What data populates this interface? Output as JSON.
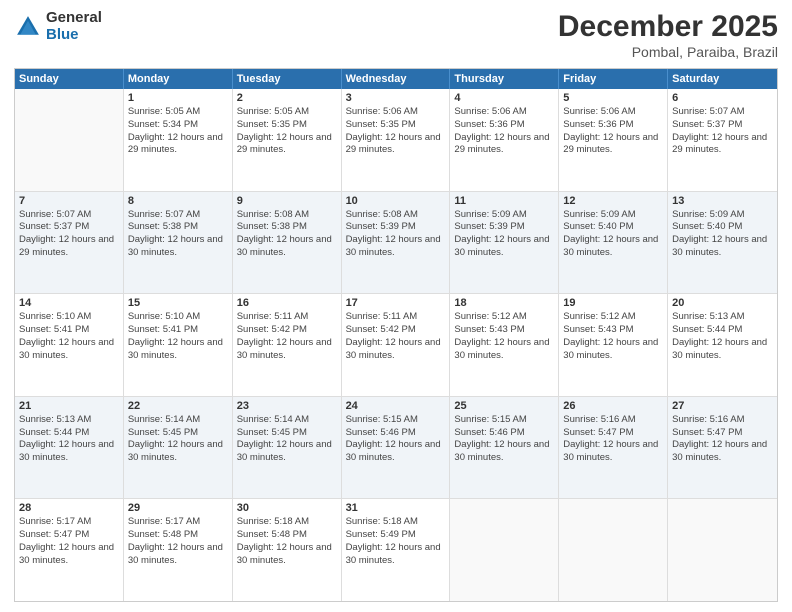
{
  "logo": {
    "general": "General",
    "blue": "Blue"
  },
  "title": {
    "month": "December 2025",
    "location": "Pombal, Paraiba, Brazil"
  },
  "header_days": [
    "Sunday",
    "Monday",
    "Tuesday",
    "Wednesday",
    "Thursday",
    "Friday",
    "Saturday"
  ],
  "weeks": [
    [
      {
        "day": "",
        "sunrise": "",
        "sunset": "",
        "daylight": ""
      },
      {
        "day": "1",
        "sunrise": "Sunrise: 5:05 AM",
        "sunset": "Sunset: 5:34 PM",
        "daylight": "Daylight: 12 hours and 29 minutes."
      },
      {
        "day": "2",
        "sunrise": "Sunrise: 5:05 AM",
        "sunset": "Sunset: 5:35 PM",
        "daylight": "Daylight: 12 hours and 29 minutes."
      },
      {
        "day": "3",
        "sunrise": "Sunrise: 5:06 AM",
        "sunset": "Sunset: 5:35 PM",
        "daylight": "Daylight: 12 hours and 29 minutes."
      },
      {
        "day": "4",
        "sunrise": "Sunrise: 5:06 AM",
        "sunset": "Sunset: 5:36 PM",
        "daylight": "Daylight: 12 hours and 29 minutes."
      },
      {
        "day": "5",
        "sunrise": "Sunrise: 5:06 AM",
        "sunset": "Sunset: 5:36 PM",
        "daylight": "Daylight: 12 hours and 29 minutes."
      },
      {
        "day": "6",
        "sunrise": "Sunrise: 5:07 AM",
        "sunset": "Sunset: 5:37 PM",
        "daylight": "Daylight: 12 hours and 29 minutes."
      }
    ],
    [
      {
        "day": "7",
        "sunrise": "Sunrise: 5:07 AM",
        "sunset": "Sunset: 5:37 PM",
        "daylight": "Daylight: 12 hours and 29 minutes."
      },
      {
        "day": "8",
        "sunrise": "Sunrise: 5:07 AM",
        "sunset": "Sunset: 5:38 PM",
        "daylight": "Daylight: 12 hours and 30 minutes."
      },
      {
        "day": "9",
        "sunrise": "Sunrise: 5:08 AM",
        "sunset": "Sunset: 5:38 PM",
        "daylight": "Daylight: 12 hours and 30 minutes."
      },
      {
        "day": "10",
        "sunrise": "Sunrise: 5:08 AM",
        "sunset": "Sunset: 5:39 PM",
        "daylight": "Daylight: 12 hours and 30 minutes."
      },
      {
        "day": "11",
        "sunrise": "Sunrise: 5:09 AM",
        "sunset": "Sunset: 5:39 PM",
        "daylight": "Daylight: 12 hours and 30 minutes."
      },
      {
        "day": "12",
        "sunrise": "Sunrise: 5:09 AM",
        "sunset": "Sunset: 5:40 PM",
        "daylight": "Daylight: 12 hours and 30 minutes."
      },
      {
        "day": "13",
        "sunrise": "Sunrise: 5:09 AM",
        "sunset": "Sunset: 5:40 PM",
        "daylight": "Daylight: 12 hours and 30 minutes."
      }
    ],
    [
      {
        "day": "14",
        "sunrise": "Sunrise: 5:10 AM",
        "sunset": "Sunset: 5:41 PM",
        "daylight": "Daylight: 12 hours and 30 minutes."
      },
      {
        "day": "15",
        "sunrise": "Sunrise: 5:10 AM",
        "sunset": "Sunset: 5:41 PM",
        "daylight": "Daylight: 12 hours and 30 minutes."
      },
      {
        "day": "16",
        "sunrise": "Sunrise: 5:11 AM",
        "sunset": "Sunset: 5:42 PM",
        "daylight": "Daylight: 12 hours and 30 minutes."
      },
      {
        "day": "17",
        "sunrise": "Sunrise: 5:11 AM",
        "sunset": "Sunset: 5:42 PM",
        "daylight": "Daylight: 12 hours and 30 minutes."
      },
      {
        "day": "18",
        "sunrise": "Sunrise: 5:12 AM",
        "sunset": "Sunset: 5:43 PM",
        "daylight": "Daylight: 12 hours and 30 minutes."
      },
      {
        "day": "19",
        "sunrise": "Sunrise: 5:12 AM",
        "sunset": "Sunset: 5:43 PM",
        "daylight": "Daylight: 12 hours and 30 minutes."
      },
      {
        "day": "20",
        "sunrise": "Sunrise: 5:13 AM",
        "sunset": "Sunset: 5:44 PM",
        "daylight": "Daylight: 12 hours and 30 minutes."
      }
    ],
    [
      {
        "day": "21",
        "sunrise": "Sunrise: 5:13 AM",
        "sunset": "Sunset: 5:44 PM",
        "daylight": "Daylight: 12 hours and 30 minutes."
      },
      {
        "day": "22",
        "sunrise": "Sunrise: 5:14 AM",
        "sunset": "Sunset: 5:45 PM",
        "daylight": "Daylight: 12 hours and 30 minutes."
      },
      {
        "day": "23",
        "sunrise": "Sunrise: 5:14 AM",
        "sunset": "Sunset: 5:45 PM",
        "daylight": "Daylight: 12 hours and 30 minutes."
      },
      {
        "day": "24",
        "sunrise": "Sunrise: 5:15 AM",
        "sunset": "Sunset: 5:46 PM",
        "daylight": "Daylight: 12 hours and 30 minutes."
      },
      {
        "day": "25",
        "sunrise": "Sunrise: 5:15 AM",
        "sunset": "Sunset: 5:46 PM",
        "daylight": "Daylight: 12 hours and 30 minutes."
      },
      {
        "day": "26",
        "sunrise": "Sunrise: 5:16 AM",
        "sunset": "Sunset: 5:47 PM",
        "daylight": "Daylight: 12 hours and 30 minutes."
      },
      {
        "day": "27",
        "sunrise": "Sunrise: 5:16 AM",
        "sunset": "Sunset: 5:47 PM",
        "daylight": "Daylight: 12 hours and 30 minutes."
      }
    ],
    [
      {
        "day": "28",
        "sunrise": "Sunrise: 5:17 AM",
        "sunset": "Sunset: 5:47 PM",
        "daylight": "Daylight: 12 hours and 30 minutes."
      },
      {
        "day": "29",
        "sunrise": "Sunrise: 5:17 AM",
        "sunset": "Sunset: 5:48 PM",
        "daylight": "Daylight: 12 hours and 30 minutes."
      },
      {
        "day": "30",
        "sunrise": "Sunrise: 5:18 AM",
        "sunset": "Sunset: 5:48 PM",
        "daylight": "Daylight: 12 hours and 30 minutes."
      },
      {
        "day": "31",
        "sunrise": "Sunrise: 5:18 AM",
        "sunset": "Sunset: 5:49 PM",
        "daylight": "Daylight: 12 hours and 30 minutes."
      },
      {
        "day": "",
        "sunrise": "",
        "sunset": "",
        "daylight": ""
      },
      {
        "day": "",
        "sunrise": "",
        "sunset": "",
        "daylight": ""
      },
      {
        "day": "",
        "sunrise": "",
        "sunset": "",
        "daylight": ""
      }
    ]
  ]
}
